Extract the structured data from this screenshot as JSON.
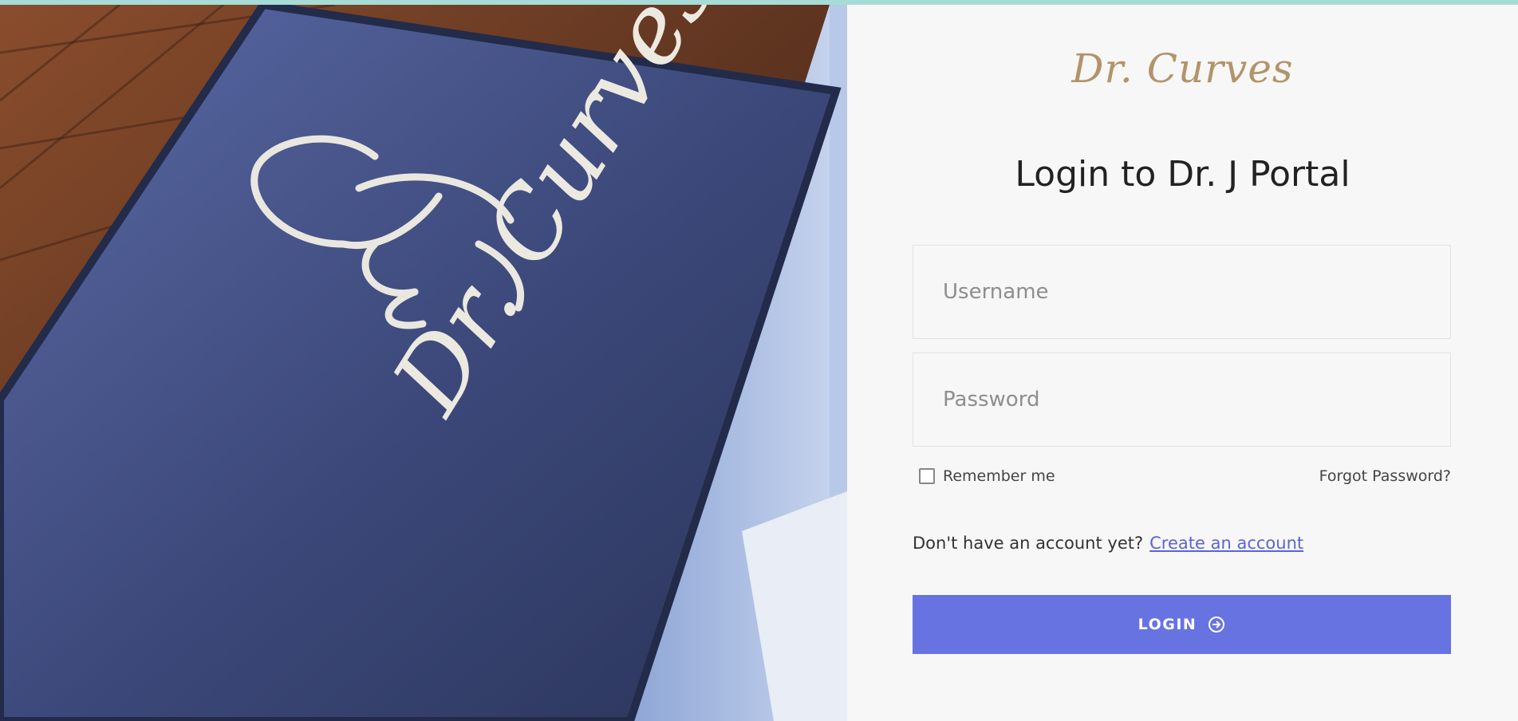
{
  "brand": {
    "logo_text": "Dr. Curves",
    "logo_color": "#b39369",
    "mat_text": "Dr. Curves"
  },
  "login": {
    "title": "Login to Dr. J Portal",
    "username_placeholder": "Username",
    "password_placeholder": "Password",
    "remember_label": "Remember me",
    "remember_checked": false,
    "forgot_label": "Forgot Password?",
    "signup_prompt": "Don't have an account yet?",
    "signup_link": "Create an account",
    "submit_label": "LOGIN",
    "submit_icon": "arrow-circle-right-icon"
  },
  "colors": {
    "accent": "#6873e2",
    "link": "#5b64d6",
    "top_bar": "#a7dcd6",
    "panel_bg": "#f7f7f7"
  }
}
